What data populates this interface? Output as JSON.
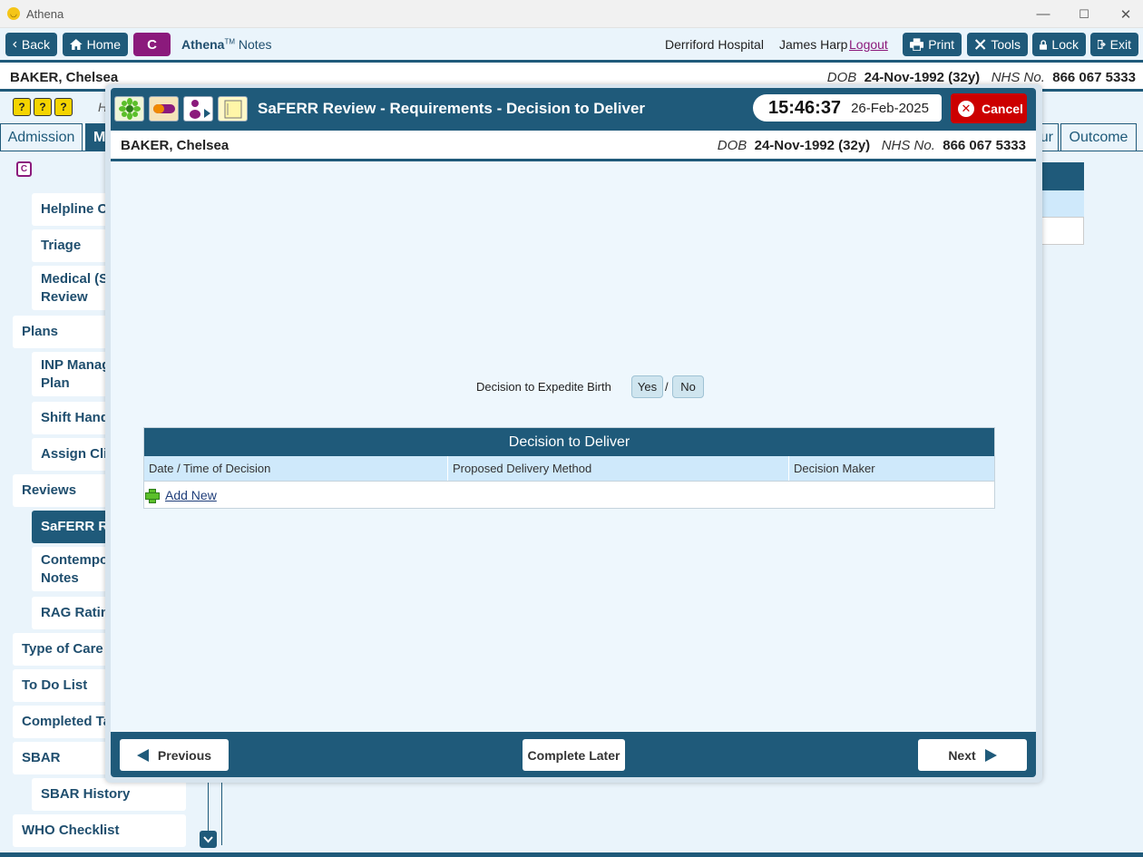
{
  "window": {
    "title": "Athena",
    "minimize": "—",
    "maximize": "☐",
    "close": "✕"
  },
  "toolbar": {
    "back": "Back",
    "home": "Home",
    "badge": "C",
    "brand": "Athena",
    "brand_tm": "TM",
    "module": "Notes",
    "hospital": "Derriford Hospital",
    "user": "James Harp",
    "logout": "Logout",
    "print": "Print",
    "tools": "Tools",
    "lock": "Lock",
    "exit": "Exit"
  },
  "patient": {
    "name": "BAKER, Chelsea",
    "dob_label": "DOB",
    "dob": "24-Nov-1992 (32y)",
    "nhs_label": "NHS No.",
    "nhs": "866 067 5333"
  },
  "help_icons": [
    "?",
    "?",
    "?"
  ],
  "help_label": "H",
  "tabs": {
    "admission": "Admission",
    "active_tab": "M",
    "partial_right": "ur",
    "outcome": "Outcome"
  },
  "nav": {
    "c_icon": "C",
    "helpline": "Helpline Co",
    "triage": "Triage",
    "medical": "Medical (Sa",
    "medical2": "Review",
    "plans": "Plans",
    "inp": "INP Manag",
    "inp2": "Plan",
    "shift": "Shift Hando",
    "assign": "Assign Clin",
    "reviews": "Reviews",
    "saferr": "SaFERR Rev",
    "contempo": "Contempor",
    "contempo2": "Notes",
    "rag": "RAG Rating",
    "typecare": "Type of Care",
    "todo": "To Do List",
    "completed": "Completed Ta",
    "sbar": "SBAR",
    "sbarhist": "SBAR History",
    "who": "WHO Checklist"
  },
  "modal": {
    "title": "SaFERR Review - Requirements - Decision to Deliver",
    "time": "15:46:37",
    "date": "26-Feb-2025",
    "cancel": "Cancel",
    "decision_label": "Decision to Expedite Birth",
    "yes": "Yes",
    "slash": "/",
    "no": "No",
    "table": {
      "title": "Decision to Deliver",
      "columns": [
        "Date / Time of Decision",
        "Proposed Delivery Method",
        "Decision Maker"
      ],
      "add_new": "Add New"
    },
    "footer": {
      "previous": "Previous",
      "complete_later": "Complete Later",
      "next": "Next"
    }
  },
  "colors": {
    "primary": "#1f5a7a",
    "accent": "#8b1a7c",
    "cancel": "#cc0000",
    "header_light": "#cfe9fb"
  }
}
